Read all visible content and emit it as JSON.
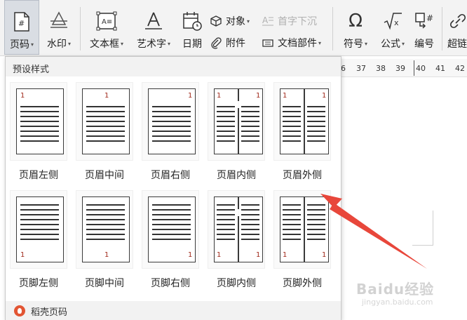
{
  "ribbon": {
    "page_number": "页码",
    "watermark": "水印",
    "text_box": "文本框",
    "art_text": "艺术字",
    "date": "日期",
    "object": "对象",
    "attachment": "附件",
    "drop_cap": "首字下沉",
    "doc_parts": "文档部件",
    "symbol": "符号",
    "formula": "公式",
    "numbering": "编号",
    "hyperlink": "超链"
  },
  "ruler": {
    "ticks": [
      "6",
      "37",
      "38",
      "39",
      "40",
      "41",
      "42"
    ]
  },
  "panel": {
    "title": "预设样式",
    "footer": "稻壳页码",
    "header_styles": [
      {
        "label": "页眉左侧",
        "num": "1"
      },
      {
        "label": "页眉中间",
        "num": "1"
      },
      {
        "label": "页眉右侧",
        "num": "1"
      },
      {
        "label": "页眉内侧",
        "num_left": "1",
        "num_right": "1"
      },
      {
        "label": "页眉外侧",
        "num_left": "1",
        "num_right": "1"
      }
    ],
    "footer_styles": [
      {
        "label": "页脚左侧",
        "num": "1"
      },
      {
        "label": "页脚中间",
        "num": "1"
      },
      {
        "label": "页脚右侧",
        "num": "1"
      },
      {
        "label": "页脚内侧",
        "num_left": "1",
        "num_right": "1"
      },
      {
        "label": "页脚外侧",
        "num_left": "1",
        "num_right": "1"
      }
    ]
  },
  "watermark_text": {
    "brand": "Baidu经验",
    "url": "jingyan.baidu.com"
  },
  "colors": {
    "accent_arrow": "#e8473b",
    "page_number": "#a0291b"
  }
}
